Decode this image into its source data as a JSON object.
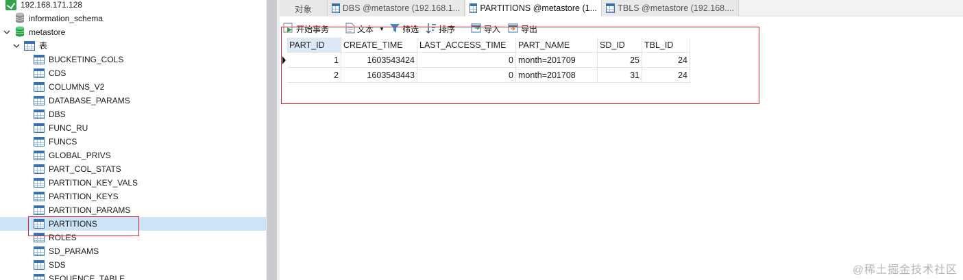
{
  "tree": {
    "server": "192.168.171.128",
    "db_info": "information_schema",
    "db_meta": "metastore",
    "tables_folder": "表",
    "tables": [
      "BUCKETING_COLS",
      "CDS",
      "COLUMNS_V2",
      "DATABASE_PARAMS",
      "DBS",
      "FUNC_RU",
      "FUNCS",
      "GLOBAL_PRIVS",
      "PART_COL_STATS",
      "PARTITION_KEY_VALS",
      "PARTITION_KEYS",
      "PARTITION_PARAMS",
      "PARTITIONS",
      "ROLES",
      "SD_PARAMS",
      "SDS",
      "SEQUENCE_TABLE"
    ],
    "selected_table": "PARTITIONS"
  },
  "tabs": {
    "objects": "对象",
    "dbs": "DBS @metastore (192.168.1...",
    "partitions": "PARTITIONS @metastore (1...",
    "tbls": "TBLS @metastore (192.168...."
  },
  "toolbar": {
    "begin_tx": "开始事务",
    "text": "文本",
    "filter": "筛选",
    "sort": "排序",
    "import": "导入",
    "export": "导出"
  },
  "grid": {
    "columns": [
      "PART_ID",
      "CREATE_TIME",
      "LAST_ACCESS_TIME",
      "PART_NAME",
      "SD_ID",
      "TBL_ID"
    ],
    "rows": [
      [
        "1",
        "1603543424",
        "0",
        "month=201709",
        "25",
        "24"
      ],
      [
        "2",
        "1603543443",
        "0",
        "month=201708",
        "31",
        "24"
      ]
    ]
  },
  "colors": {
    "accent_green": "#31a24c",
    "selection": "#cce4f7",
    "highlight_box": "#e0262b"
  },
  "watermark": "@稀土掘金技术社区"
}
